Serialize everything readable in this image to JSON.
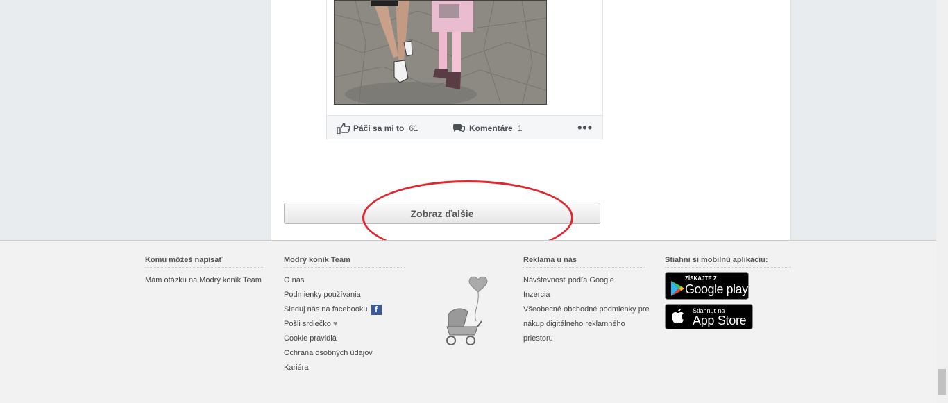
{
  "post": {
    "like_label": "Páči sa mi to",
    "like_count": "61",
    "comment_label": "Komentáre",
    "comment_count": "1",
    "more_label": "•••"
  },
  "load_more_label": "Zobraz ďalšie",
  "footer": {
    "col1": {
      "title": "Komu môžeš napísať",
      "links": [
        "Mám otázku na Modrý koník Team"
      ]
    },
    "col2": {
      "title": "Modrý koník Team",
      "links": [
        "O nás",
        "Podmienky používania",
        "Sleduj nás na facebooku",
        "Pošli srdiečko",
        "Cookie pravidlá",
        "Ochrana osobných údajov",
        "Kariéra"
      ]
    },
    "col3": {
      "title": "Reklama u nás",
      "links": [
        "Návštevnosť podľa Google",
        "Inzercia",
        "Všeobecné obchodné podmienky pre",
        "nákup digitálneho reklamného",
        "priestoru"
      ]
    },
    "col4": {
      "title": "Stiahni si mobilnú aplikáciu:",
      "google_small": "ZÍSKAJTE Z",
      "google_big": "Google play",
      "apple_small": "Stiahnuť na",
      "apple_big": "App Store"
    }
  },
  "icons": [
    "like-icon",
    "comment-icon",
    "facebook-icon",
    "heart-icon",
    "stroller-balloon-icon",
    "google-play-icon",
    "apple-icon"
  ]
}
